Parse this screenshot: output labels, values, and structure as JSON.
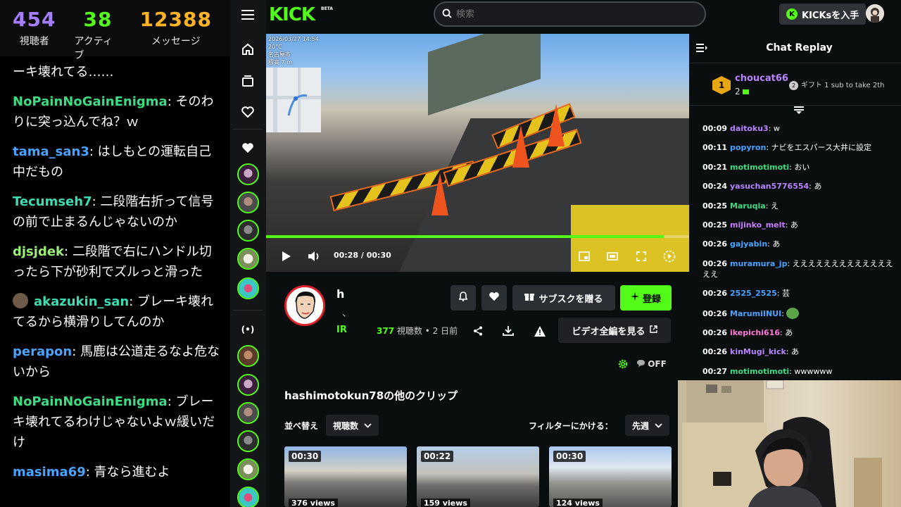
{
  "overlay": {
    "stats": [
      {
        "value": "454",
        "label": "視聴者",
        "color": "#a57dff"
      },
      {
        "value": "38",
        "label": "アクティブ",
        "color": "#53fc18"
      },
      {
        "value": "12388",
        "label": "メッセージ",
        "color": "#ffb325"
      }
    ],
    "messages": [
      {
        "user": "",
        "text": "ーキ壊れてる……",
        "color": "#ffffff"
      },
      {
        "user": "NoPainNoGainEnigma",
        "text": "そのわりに突っ込んでね？ｗ",
        "color": "#3ddc84"
      },
      {
        "user": "tama_san3",
        "text": "はしもとの運転自己中だもの",
        "color": "#4aa3ff"
      },
      {
        "user": "Tecumseh7",
        "text": "二段階右折って信号の前で止まるんじゃないのか",
        "color": "#3ddcb4"
      },
      {
        "user": "djsjdek",
        "text": "二段階で右にハンドル切ったら下が砂利でズルっと滑った",
        "color": "#9cf07a"
      },
      {
        "user": "akazukin_san",
        "text": "ブレーキ壊れてるから横滑りしてんのか",
        "color": "#3ddcb4"
      },
      {
        "user": "perapon",
        "text": "馬鹿は公道走るなよ危ないから",
        "color": "#4aa3ff"
      },
      {
        "user": "NoPainNoGainEnigma",
        "text": "ブレーキ壊れてるわけじゃないよｗ緩いだけ",
        "color": "#3ddc84"
      },
      {
        "user": "masima69",
        "text": "青なら進むよ",
        "color": "#4aa3ff"
      }
    ]
  },
  "nav": {
    "logo": "KICK",
    "beta": "BETA",
    "search_placeholder": "検索",
    "get_kicks": "KICKsを入手"
  },
  "video": {
    "hud_date": "2026/03/27 14:54",
    "hud_temp": "20°C",
    "hud_place": "名古屋市",
    "hud_alt": "標高 7 m",
    "current_time": "00:28",
    "total_time": "00:30",
    "time_separator": "/",
    "progress": 0.94
  },
  "channel": {
    "name": "h",
    "subline": "、",
    "tag": "IR",
    "views_count": "377",
    "views_label": "視聴数",
    "dot": "•",
    "age": "2 日前",
    "gift_sub": "サブスクを贈る",
    "follow": "登録",
    "full_video": "ビデオ全編を見る",
    "off": "OFF"
  },
  "clips": {
    "title": "hashimotokun78の他のクリップ",
    "sort_label": "並べ替え",
    "sort_value": "視聴数",
    "filter_label": "フィルターにかける：",
    "filter_value": "先週",
    "items": [
      {
        "duration": "00:30",
        "views": "376 views"
      },
      {
        "duration": "00:22",
        "views": "159 views"
      },
      {
        "duration": "00:30",
        "views": "124 views"
      }
    ]
  },
  "chat": {
    "title": "Chat Replay",
    "pinned": {
      "rank": "1",
      "user": "choucat66",
      "count": "2",
      "gift_num": "2",
      "gift_text": "ギフト 1 sub to take 2th"
    },
    "lines": [
      {
        "ts": "00:09",
        "user": "daitoku3",
        "text": "w",
        "color": "#b884ff"
      },
      {
        "ts": "00:11",
        "user": "popyron",
        "text": "ナビをエスパース大井に設定",
        "color": "#4aa3ff"
      },
      {
        "ts": "00:21",
        "user": "motimotimoti",
        "text": "おい",
        "color": "#3ddc84"
      },
      {
        "ts": "00:24",
        "user": "yasuchan5776554",
        "text": "あ",
        "color": "#b884ff"
      },
      {
        "ts": "00:25",
        "user": "Maruqia",
        "text": "え",
        "color": "#3ddc84"
      },
      {
        "ts": "00:25",
        "user": "mijinko_melt",
        "text": "あ",
        "color": "#c77dff"
      },
      {
        "ts": "00:26",
        "user": "gajyabin",
        "text": "あ",
        "color": "#4aa3ff"
      },
      {
        "ts": "00:26",
        "user": "muramura_jp",
        "text": "えええええええええええええええ",
        "color": "#4aa3ff"
      },
      {
        "ts": "00:26",
        "user": "2525_2525",
        "text": "芸",
        "color": "#4aa3ff"
      },
      {
        "ts": "00:26",
        "user": "MarumiINUI",
        "text": "",
        "color": "#4aa3ff"
      },
      {
        "ts": "00:26",
        "user": "ikepichi616",
        "text": "あ",
        "color": "#ff7ad6"
      },
      {
        "ts": "00:26",
        "user": "kinMugi_kick",
        "text": "あ",
        "color": "#b884ff"
      },
      {
        "ts": "00:27",
        "user": "motimotimoti",
        "text": "wwwwww",
        "color": "#3ddc84"
      }
    ]
  }
}
